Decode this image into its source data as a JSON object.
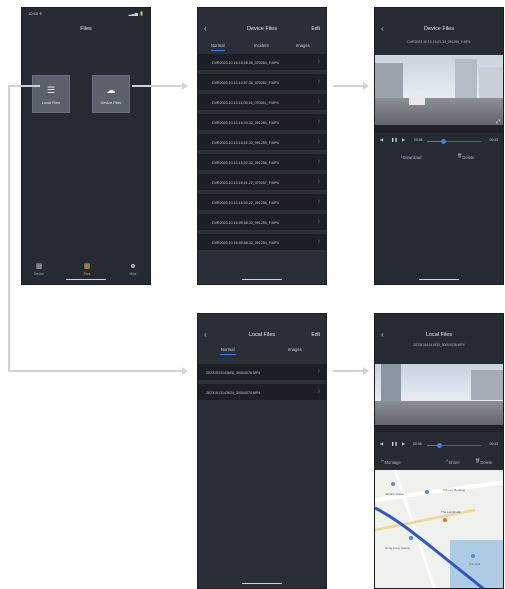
{
  "home": {
    "status_time": "10:59 ✈",
    "status_icons": "▂▃▅ 🔋",
    "title": "Files",
    "cards": [
      {
        "label": "Local Files",
        "icon": "layers-icon"
      },
      {
        "label": "Device Files",
        "icon": "cloud-icon"
      }
    ],
    "bottom_nav": [
      {
        "label": "Device",
        "icon": "camera-icon"
      },
      {
        "label": "Files",
        "icon": "folder-icon"
      },
      {
        "label": "Mine",
        "icon": "user-icon"
      }
    ]
  },
  "device_files": {
    "title": "Device Files",
    "edit": "Edit",
    "tabs": [
      "Normal",
      "Incident",
      "Images"
    ],
    "files": [
      "DVR2023.10.16-15,08,36_070264_F.MP4",
      "DVR2023.10.13-10,07,36_070262_F.MP4",
      "DVR2023.10.13-11,05,16_070261_F.MP4",
      "DVR2023.10.13-16,04,32_091260_F.MP4",
      "DVR2023.10.13-16,02,32_091259_F.MP4",
      "DVR2023.10.13-15,02,32_091258_F.MP4",
      "DVR2023.10.13-16,01,22_070257_F.MP4",
      "DVR2023.10.13-16,00,22_091256_F.MP4",
      "DVR2023.10.16-09,58,32_091255_F.MP4",
      "DVR2023.10.16-09,58,32_091254_F.MP4"
    ]
  },
  "player_device": {
    "title": "Device Files",
    "filename": "DVR2023.10.13-15,01,33_091255_F.MP4",
    "time_start": "00:08",
    "time_end": "00:43",
    "progress": 0.3,
    "download": "Download",
    "delete": "Delete"
  },
  "local_files": {
    "title": "Local Files",
    "edit": "Edit",
    "tabs": [
      "Normal",
      "Images"
    ],
    "files": [
      "20231013143608_30004076.MP4",
      "20231013143624_30004074.MP4"
    ]
  },
  "player_local": {
    "title": "Local Files",
    "filename": "20231016141633_30004036.MP4",
    "time_start": "00:08",
    "time_end": "00:43",
    "progress": 0.22,
    "actions": [
      "Montage",
      "Share",
      "Delete"
    ],
    "map_labels": [
      "Jardine House",
      "Prince's Building",
      "The Landmark",
      "Hong Kong Station",
      "City Hall"
    ]
  },
  "colors": {
    "accent": "#3b7ff0",
    "bg": "#262a33",
    "row": "#1c1f26"
  }
}
